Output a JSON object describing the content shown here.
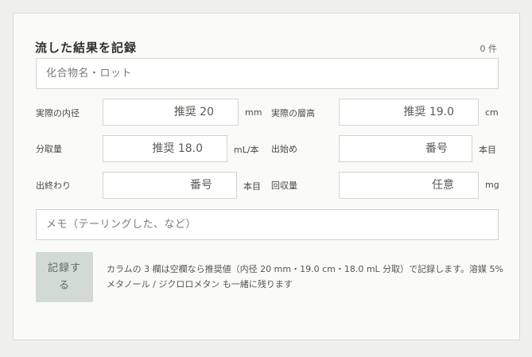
{
  "form": {
    "title": "流した結果を記録",
    "count": "0 件",
    "compound_placeholder": "化合物名・ロット",
    "fields": {
      "inner_diameter": {
        "label": "実際の内径",
        "placeholder": "推奨 20",
        "unit": "mm"
      },
      "bed_height": {
        "label": "実際の層高",
        "placeholder": "推奨 19.0",
        "unit": "cm"
      },
      "fraction_volume": {
        "label": "分取量",
        "placeholder": "推奨 18.0",
        "unit": "mL/本"
      },
      "start": {
        "label": "出始め",
        "placeholder": "番号",
        "unit": "本目"
      },
      "end": {
        "label": "出終わり",
        "placeholder": "番号",
        "unit": "本目"
      },
      "recovery": {
        "label": "回収量",
        "placeholder": "任意",
        "unit": "mg"
      }
    },
    "memo_placeholder": "メモ（テーリングした、など）",
    "submit_label": "記録する",
    "note": "カラムの 3 欄は空欄なら推奨値（内径 20 mm・19.0 cm・18.0 mL 分取）で記録します。溶媒 5% メタノール / ジクロロメタン も一緒に残ります"
  }
}
